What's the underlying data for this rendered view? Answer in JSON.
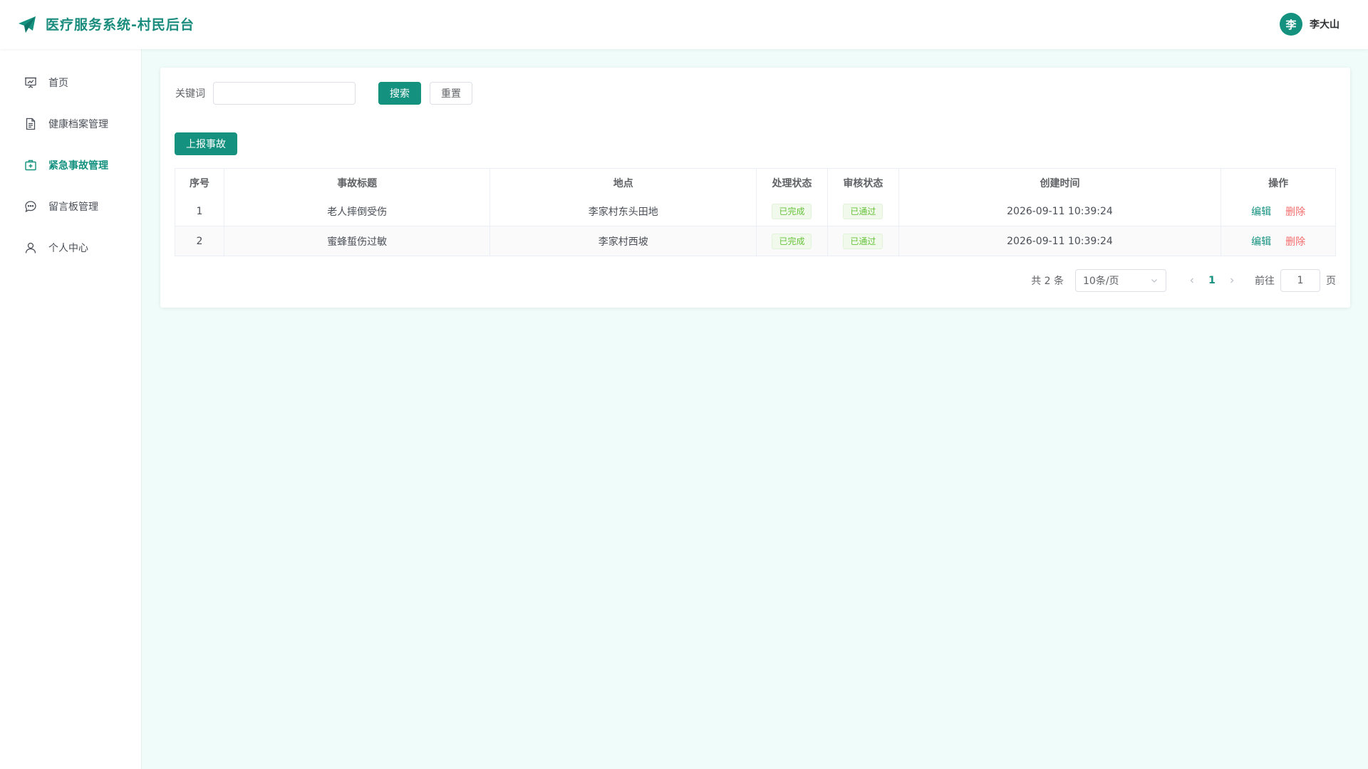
{
  "header": {
    "title": "医疗服务系统-村民后台",
    "user_avatar_char": "李",
    "user_name": "李大山"
  },
  "colors": {
    "brand": "#14917f",
    "page_bg": "#f0fcf9",
    "success_tag": "#67c23a",
    "danger": "#f56c6c"
  },
  "sidebar": {
    "items": [
      {
        "label": "首页",
        "icon": "presentation-icon",
        "active": false
      },
      {
        "label": "健康档案管理",
        "icon": "document-icon",
        "active": false
      },
      {
        "label": "紧急事故管理",
        "icon": "first-aid-kit-icon",
        "active": true
      },
      {
        "label": "留言板管理",
        "icon": "chat-bubble-icon",
        "active": false
      },
      {
        "label": "个人中心",
        "icon": "user-icon",
        "active": false
      }
    ]
  },
  "search": {
    "label": "关键词",
    "value": "",
    "placeholder": "",
    "search_button": "搜索",
    "reset_button": "重置"
  },
  "toolbar": {
    "report_button": "上报事故"
  },
  "table": {
    "columns": [
      "序号",
      "事故标题",
      "地点",
      "处理状态",
      "审核状态",
      "创建时间",
      "操作"
    ],
    "rows": [
      {
        "index": "1",
        "title": "老人摔倒受伤",
        "location": "李家村东头田地",
        "process_status": "已完成",
        "review_status": "已通过",
        "created_at": "2026-09-11 10:39:24",
        "edit": "编辑",
        "delete": "删除"
      },
      {
        "index": "2",
        "title": "蜜蜂蜇伤过敏",
        "location": "李家村西坡",
        "process_status": "已完成",
        "review_status": "已通过",
        "created_at": "2026-09-11 10:39:24",
        "edit": "编辑",
        "delete": "删除"
      }
    ]
  },
  "pagination": {
    "total_text": "共 2 条",
    "page_size": "10条/页",
    "current_page": "1",
    "goto_label": "前往",
    "goto_value": "1",
    "goto_unit": "页"
  }
}
